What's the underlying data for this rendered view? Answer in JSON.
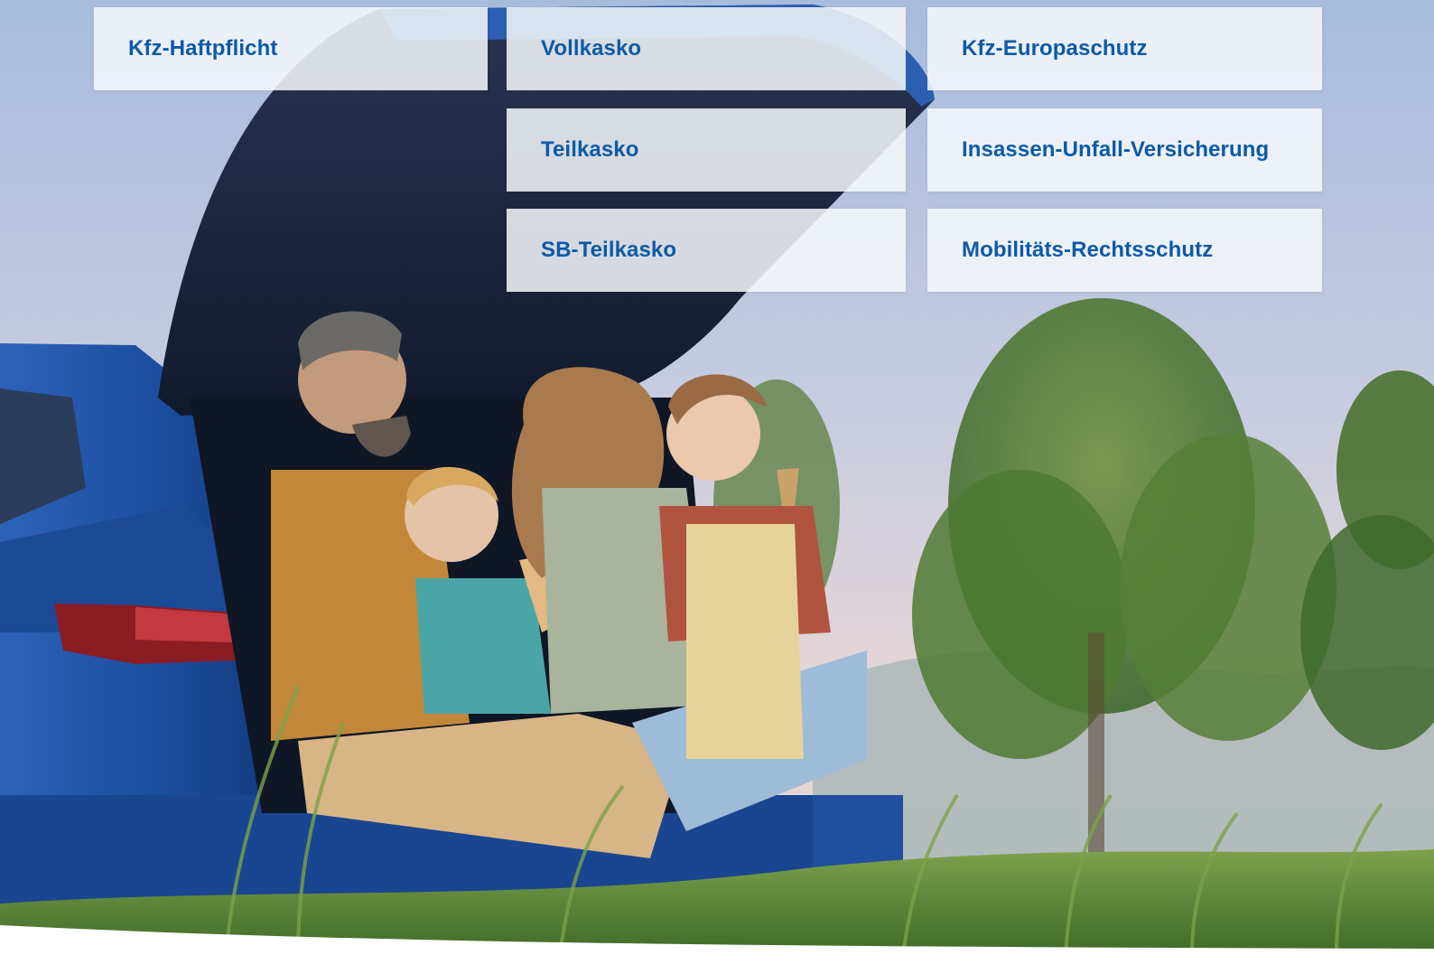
{
  "colors": {
    "link": "#0d5aa7",
    "tile_background": "#f3f6fb",
    "sky_top": "#a9bedf",
    "sky_bottom": "#e6d6d6",
    "car_blue": "#1e4f9c",
    "grass": "#5d8a3a"
  },
  "hero_image": {
    "icon": "family-at-car-trunk-photo"
  },
  "tiles": [
    {
      "label": "Kfz-Haftpflicht"
    },
    {
      "label": "Vollkasko"
    },
    {
      "label": "Kfz-Europaschutz"
    },
    {
      "label": "Teilkasko"
    },
    {
      "label": "Insassen-Unfall-Versicherung"
    },
    {
      "label": "SB-Teilkasko"
    },
    {
      "label": "Mobilitäts-Rechtsschutz"
    }
  ]
}
